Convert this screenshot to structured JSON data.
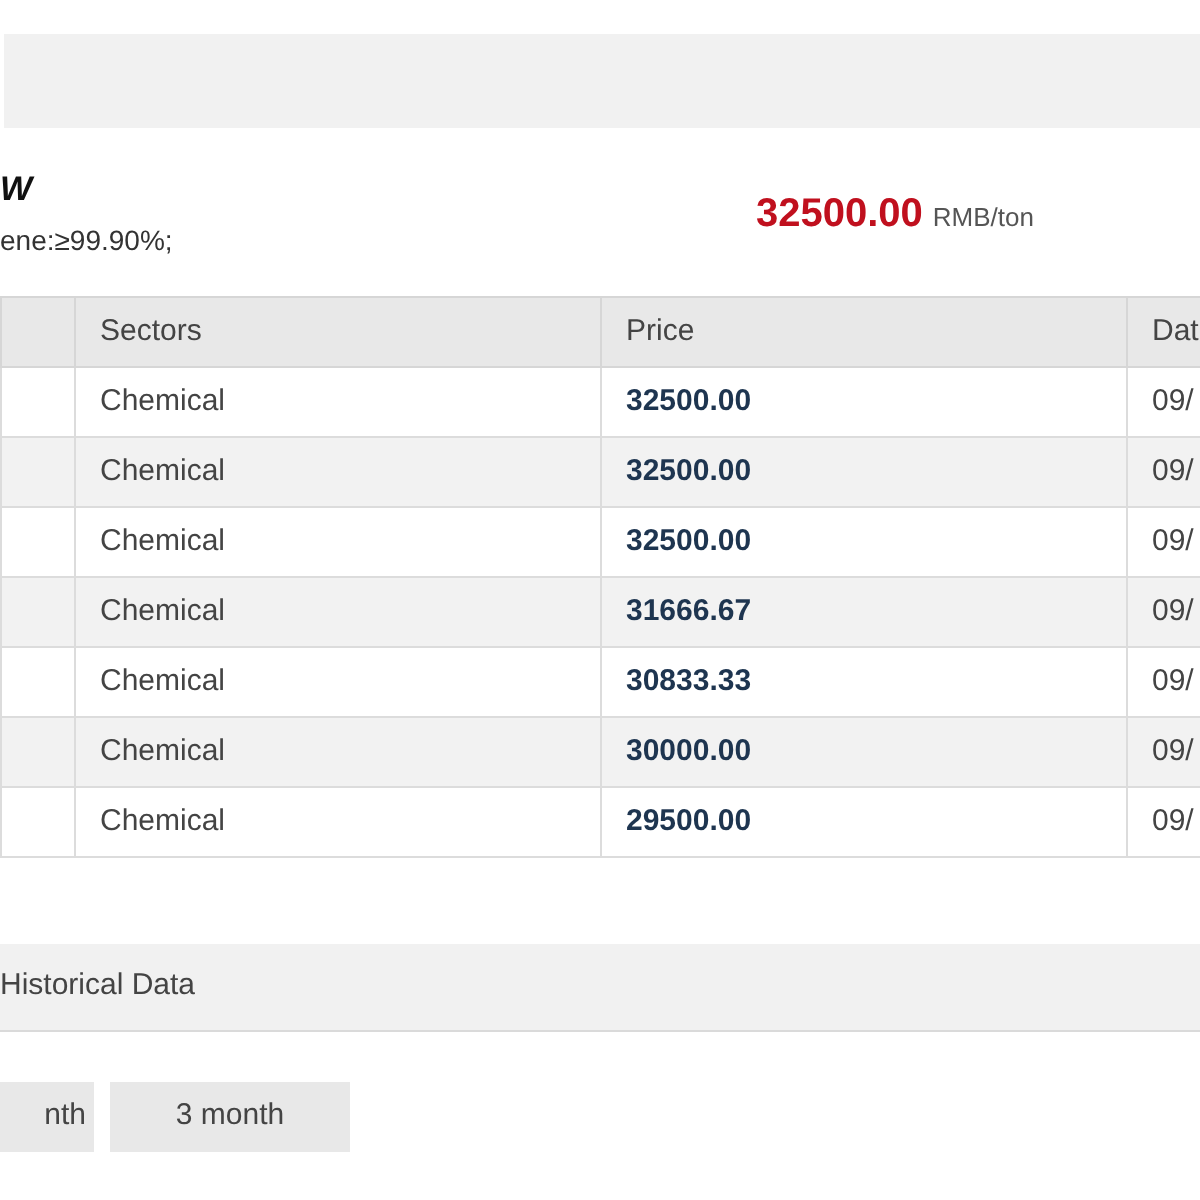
{
  "product": {
    "title": "W",
    "spec": "ene:≥99.90%;",
    "price": "32500.00",
    "unit": "RMB/ton"
  },
  "table": {
    "columns": [
      "",
      "Sectors",
      "Price",
      "Dat"
    ],
    "rows": [
      [
        "",
        "Chemical",
        "32500.00",
        "09/"
      ],
      [
        "",
        "Chemical",
        "32500.00",
        "09/"
      ],
      [
        "",
        "Chemical",
        "32500.00",
        "09/"
      ],
      [
        "",
        "Chemical",
        "31666.67",
        "09/"
      ],
      [
        "",
        "Chemical",
        "30833.33",
        "09/"
      ],
      [
        "",
        "Chemical",
        "30000.00",
        "09/"
      ],
      [
        "",
        "Chemical",
        "29500.00",
        "09/"
      ]
    ]
  },
  "history": {
    "title": "Historical Data",
    "buttons": [
      "nth",
      "3 month"
    ]
  }
}
